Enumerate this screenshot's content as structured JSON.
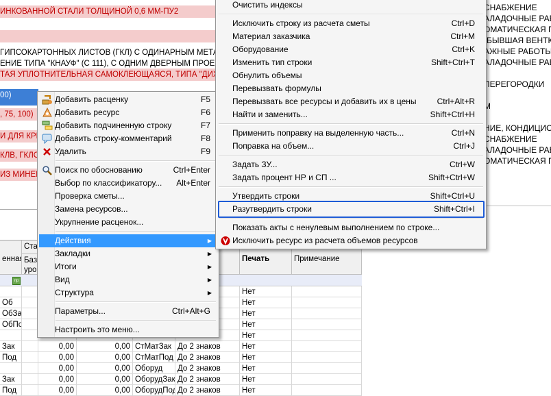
{
  "background": {
    "rows": [
      {
        "text": "ИНКОВАННОЙ СТАЛИ ТОЛЩИНОЙ 0,6 ММ-ПУ2",
        "style": "pink redtxt"
      },
      {
        "text": "",
        "style": "pink"
      },
      {
        "text": "",
        "style": "pink"
      },
      {
        "text": " ГИПСОКАРТОННЫХ ЛИСТОВ (ГКЛ) С ОДИНАРНЫМ МЕТАЛ",
        "style": ""
      },
      {
        "text": "ЕНИЕ ТИПА \"КНАУФ\" (С 111), С ОДНИМ ДВЕРНЫМ ПРОЕМО",
        "style": ""
      },
      {
        "text": "ТАЯ УПЛОТНИТЕЛЬНАЯ САМОКЛЕЮЩАЯСЯ, ТИПА \"ДИХТУНГ",
        "style": "redtxt"
      },
      {
        "text": "00)",
        "style": "blue-band"
      },
      {
        "text": ", 75, 100)",
        "style": "redtxt"
      },
      {
        "text": "",
        "style": ""
      },
      {
        "text": "И ДЛЯ КРЕ",
        "style": "redtxt"
      },
      {
        "text": "",
        "style": ""
      },
      {
        "text": "КЛВ, ГКЛО,",
        "style": "redtxt"
      },
      {
        "text": "",
        "style": ""
      },
      {
        "text": "ИЗ МИНЕРА",
        "style": "redtxt"
      }
    ],
    "right_lines": [
      "СНАБЖЕНИЕ",
      "АЛАДОЧНЫЕ РАБ",
      "ОМАТИЧЕСКАЯ ПО",
      "(БЫВШАЯ ВЕНТКА",
      "АЖНЫЕ РАБОТЫ",
      "АЛАДОЧНЫЕ РАБОТЫ",
      "",
      "ПЕРЕГОРОДКИ",
      "",
      "М",
      "",
      "НИЕ, КОНДИЦИОН",
      "СНАБЖЕНИЕ",
      "АЛАДОЧНЫЕ РАБ",
      "ОМАТИЧЕСКАЯ ПО"
    ]
  },
  "grid": {
    "headers": {
      "col_a": "енная",
      "col_sta": "Ста",
      "col_base": "Баз урове",
      "print": "Печать",
      "note": "Примечание"
    },
    "marker": "пр",
    "rows": [
      {
        "a": "",
        "v1": "",
        "v2": "",
        "code": "",
        "digits": "",
        "print": "Нет"
      },
      {
        "a": "Об",
        "v1": "",
        "v2": "",
        "code": "",
        "digits": "",
        "print": "Нет"
      },
      {
        "a": "ОбЗак",
        "v1": "",
        "v2": "",
        "code": "",
        "digits": "",
        "print": "Нет"
      },
      {
        "a": "ОбПод",
        "v1": "",
        "v2": "",
        "code": "",
        "digits": "",
        "print": "Нет"
      },
      {
        "a": "",
        "v1": "",
        "v2": "",
        "code": "",
        "digits": "",
        "print": "Нет"
      },
      {
        "a": "Зак",
        "v1": "0,00",
        "v2": "0,00",
        "code": "СтМатЗак",
        "digits": "До 2 знаков",
        "print": "Нет"
      },
      {
        "a": "Под",
        "v1": "0,00",
        "v2": "0,00",
        "code": "СтМатПод",
        "digits": "До 2 знаков",
        "print": "Нет"
      },
      {
        "a": "",
        "v1": "0,00",
        "v2": "0,00",
        "code": "Оборуд",
        "digits": "До 2 знаков",
        "print": "Нет"
      },
      {
        "a": "Зак",
        "v1": "0,00",
        "v2": "0,00",
        "code": "ОборудЗак",
        "digits": "До 2 знаков",
        "print": "Нет"
      },
      {
        "a": "Под",
        "v1": "0,00",
        "v2": "0,00",
        "code": "ОборудПод",
        "digits": "До 2 знаков",
        "print": "Нет"
      }
    ]
  },
  "context_menu": {
    "items": [
      {
        "label": "Добавить расценку",
        "shortcut": "F5",
        "icon": "add-rate-icon"
      },
      {
        "label": "Добавить ресурс",
        "shortcut": "F6",
        "icon": "add-resource-icon"
      },
      {
        "label": "Добавить подчиненную строку",
        "shortcut": "F7",
        "icon": "add-child-row-icon"
      },
      {
        "label": "Добавить строку-комментарий",
        "shortcut": "F8",
        "icon": "add-comment-icon"
      },
      {
        "label": "Удалить",
        "shortcut": "F9",
        "icon": "delete-icon"
      },
      {
        "label": "Поиск по обоснованию",
        "shortcut": "Ctrl+Enter",
        "icon": "search-icon"
      },
      {
        "label": "Выбор по классификатору...",
        "shortcut": "Alt+Enter"
      },
      {
        "label": "Проверка сметы...",
        "shortcut": ""
      },
      {
        "label": "Замена ресурсов...",
        "shortcut": ""
      },
      {
        "label": "Укрупнение расценок...",
        "shortcut": ""
      },
      {
        "label": "Действия",
        "submenu": true
      },
      {
        "label": "Закладки",
        "submenu": true
      },
      {
        "label": "Итоги",
        "submenu": true
      },
      {
        "label": "Вид",
        "submenu": true
      },
      {
        "label": "Структура",
        "submenu": true
      },
      {
        "label": "Параметры...",
        "shortcut": "Ctrl+Alt+G"
      },
      {
        "label": "Настроить это меню...",
        "shortcut": ""
      }
    ]
  },
  "actions_submenu": {
    "items": [
      {
        "label": "Очистить индексы",
        "shortcut": ""
      },
      {
        "label": "Исключить строку из расчета сметы",
        "shortcut": "Ctrl+D"
      },
      {
        "label": "Материал заказчика",
        "shortcut": "Ctrl+M"
      },
      {
        "label": "Оборудование",
        "shortcut": "Ctrl+K"
      },
      {
        "label": "Изменить тип строки",
        "shortcut": "Shift+Ctrl+T"
      },
      {
        "label": "Обнулить объемы",
        "shortcut": ""
      },
      {
        "label": "Перевызвать формулы",
        "shortcut": ""
      },
      {
        "label": "Перевызвать все ресурсы и добавить их в цены",
        "shortcut": "Ctrl+Alt+R"
      },
      {
        "label": "Найти и заменить...",
        "shortcut": "Shift+Ctrl+H"
      },
      {
        "label": "Применить поправку на выделенную часть...",
        "shortcut": "Ctrl+N"
      },
      {
        "label": "Поправка на объем...",
        "shortcut": "Ctrl+J"
      },
      {
        "label": "Задать ЗУ...",
        "shortcut": "Ctrl+W"
      },
      {
        "label": "Задать процент НР и СП ...",
        "shortcut": "Shift+Ctrl+W"
      },
      {
        "label": "Утвердить строки",
        "shortcut": "Shift+Ctrl+U"
      },
      {
        "label": "Разутвердить строки",
        "shortcut": "Shift+Ctrl+I"
      },
      {
        "label": "Показать акты с ненулевым выполнением по строке...",
        "shortcut": ""
      },
      {
        "label": "Исключить ресурс из расчета объемов ресурсов",
        "shortcut": "",
        "icon": "exclude-resource-icon"
      }
    ]
  },
  "colors": {
    "highlight": "#3399ff",
    "focus_border": "#1e5bd6",
    "pink_row": "#f4cccc",
    "red_text": "#c00000",
    "selected_band": "#3d7fd6"
  }
}
